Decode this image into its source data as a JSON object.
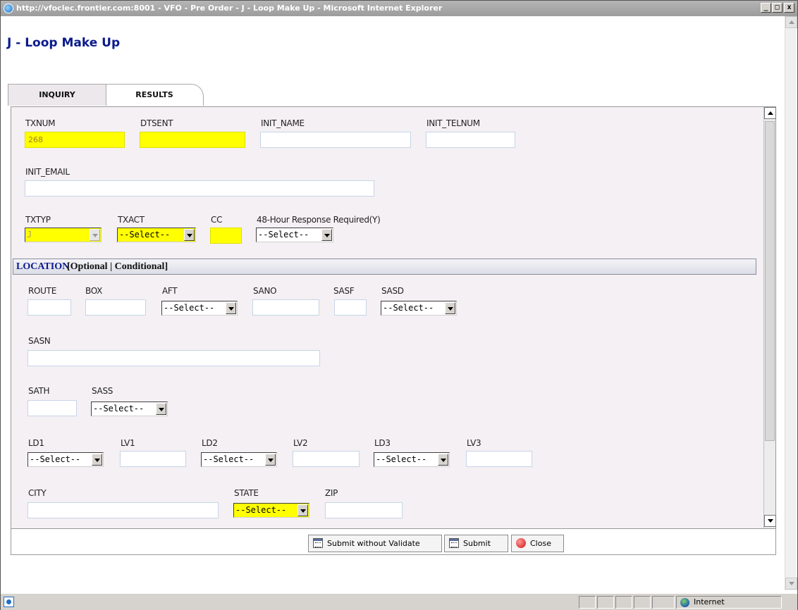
{
  "window": {
    "title": "http://vfoclec.frontier.com:8001 - VFO - Pre Order - J - Loop Make Up - Microsoft Internet Explorer",
    "minimize": "_",
    "maximize": "□",
    "close": "x"
  },
  "page_title": "J - Loop Make Up",
  "tabs": [
    {
      "label": "INQUIRY",
      "active": true
    },
    {
      "label": "RESULTS",
      "active": false
    }
  ],
  "fields": {
    "txnum": {
      "label": "TXNUM",
      "value": "268"
    },
    "dtsent": {
      "label": "DTSENT",
      "value": ""
    },
    "init_name": {
      "label": "INIT_NAME",
      "value": ""
    },
    "init_telnum": {
      "label": "INIT_TELNUM",
      "value": ""
    },
    "init_email": {
      "label": "INIT_EMAIL",
      "value": ""
    },
    "txtyp": {
      "label": "TXTYP",
      "value": "J"
    },
    "txact": {
      "label": "TXACT",
      "value": "--Select--"
    },
    "cc": {
      "label": "CC",
      "value": ""
    },
    "hour48": {
      "label": "48-Hour Response Required(Y)",
      "value": "--Select--"
    }
  },
  "location": {
    "title": "LOCATION",
    "subtitle": "[Optional | Conditional]",
    "route": {
      "label": "ROUTE",
      "value": ""
    },
    "box": {
      "label": "BOX",
      "value": ""
    },
    "aft": {
      "label": "AFT",
      "value": "--Select--"
    },
    "sano": {
      "label": "SANO",
      "value": ""
    },
    "sasf": {
      "label": "SASF",
      "value": ""
    },
    "sasd": {
      "label": "SASD",
      "value": "--Select--"
    },
    "sasn": {
      "label": "SASN",
      "value": ""
    },
    "sath": {
      "label": "SATH",
      "value": ""
    },
    "sass": {
      "label": "SASS",
      "value": "--Select--"
    },
    "ld1": {
      "label": "LD1",
      "value": "--Select--"
    },
    "lv1": {
      "label": "LV1",
      "value": ""
    },
    "ld2": {
      "label": "LD2",
      "value": "--Select--"
    },
    "lv2": {
      "label": "LV2",
      "value": ""
    },
    "ld3": {
      "label": "LD3",
      "value": "--Select--"
    },
    "lv3": {
      "label": "LV3",
      "value": ""
    },
    "city": {
      "label": "CITY",
      "value": ""
    },
    "state": {
      "label": "STATE",
      "value": "--Select--"
    },
    "zip": {
      "label": "ZIP",
      "value": ""
    }
  },
  "buttons": {
    "submit_without_validate": "Submit without Validate",
    "submit": "Submit",
    "close": "Close"
  },
  "statusbar": {
    "zone": "Internet"
  },
  "colors": {
    "required_highlight": "#ffff00",
    "title_blue": "#0a1a8c",
    "panel_bg": "#f4f0f3"
  }
}
